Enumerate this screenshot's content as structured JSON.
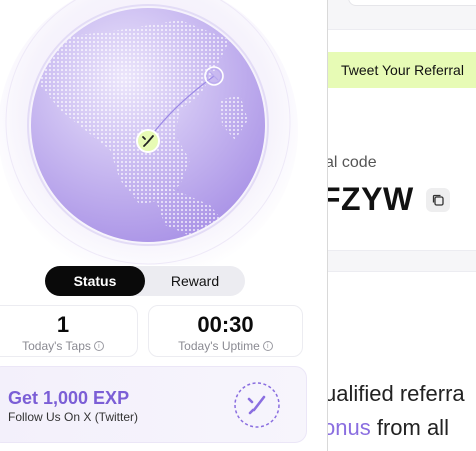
{
  "status_toggle": {
    "status_label": "Status",
    "reward_label": "Reward",
    "active": "Status"
  },
  "stats": {
    "taps_value": "1",
    "taps_label": "Today's Taps",
    "uptime_value": "00:30",
    "uptime_label": "Today's Uptime"
  },
  "exp_card": {
    "title": "Get 1,000 EXP",
    "subtitle": "Follow Us On X (Twitter)"
  },
  "referral": {
    "tweet_button": "Tweet Your Referral",
    "code_label": "al code",
    "code_value": "FZYW"
  },
  "body_text": {
    "line1": "ualified referra",
    "line2_accent": "onus",
    "line2_rest": " from all"
  },
  "icons": {
    "info": "info-icon",
    "copy": "copy-icon",
    "badge": "x-logo-badge-icon",
    "globe": "globe-icon"
  },
  "colors": {
    "accent_purple": "#7b5ed6",
    "tweet_green": "#e7fbb5",
    "toggle_active": "#0a0a0a"
  }
}
